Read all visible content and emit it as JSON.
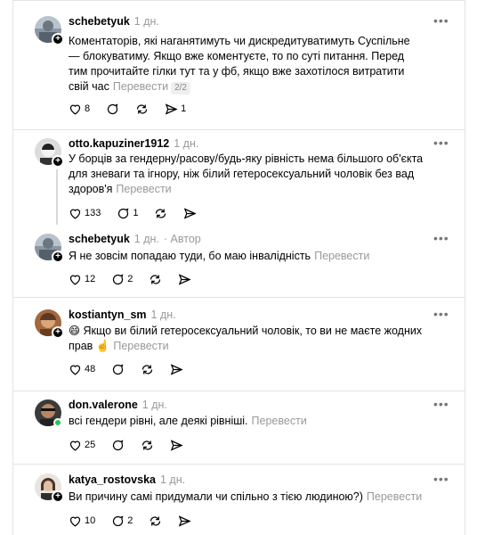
{
  "translate_label": "Перевести",
  "posts": [
    {
      "username": "schebetyuk",
      "time": "1 дн.",
      "role": "",
      "text": "Коментаторів, які наганятимуть чи дискредитуватимуть Суспільне — блокуватиму. Якщо вже коментуєте, то по суті питання. Перед тим прочитайте гілки тут та у фб, якщо вже захотілося витратити свій час",
      "pagination": "2/2",
      "likes": "8",
      "replies": "",
      "reposts": "",
      "shares": "1"
    },
    {
      "username": "otto.kapuziner1912",
      "time": "1 дн.",
      "role": "",
      "text": "У борців за гендерну/расову/будь-яку рівність нема більшого об'єкта для зневаги та ігнору, ніж білий гетеросексуальний чоловік без вад здоров'я",
      "likes": "133",
      "replies": "1",
      "reposts": "",
      "shares": ""
    },
    {
      "username": "schebetyuk",
      "time": "1 дн.",
      "role": "· Автор",
      "text": "Я не зовсім попадаю туди, бо маю інвалідність",
      "likes": "12",
      "replies": "2",
      "reposts": "",
      "shares": ""
    },
    {
      "username": "kostiantyn_sm",
      "time": "1 дн.",
      "role": "",
      "text": "😄 Якщо ви білий гетеросексуальний чоловік, то ви не маєте жодних прав ☝️",
      "likes": "48",
      "replies": "",
      "reposts": "",
      "shares": ""
    },
    {
      "username": "don.valerone",
      "time": "1 дн.",
      "role": "",
      "text": "всі гендери рівні, але деякі рівніші.",
      "likes": "25",
      "replies": "",
      "reposts": "",
      "shares": ""
    },
    {
      "username": "katya_rostovska",
      "time": "1 дн.",
      "role": "",
      "text": "Ви причину самі придумали чи спільно з тією людиною?)",
      "likes": "10",
      "replies": "2",
      "reposts": "",
      "shares": ""
    }
  ]
}
